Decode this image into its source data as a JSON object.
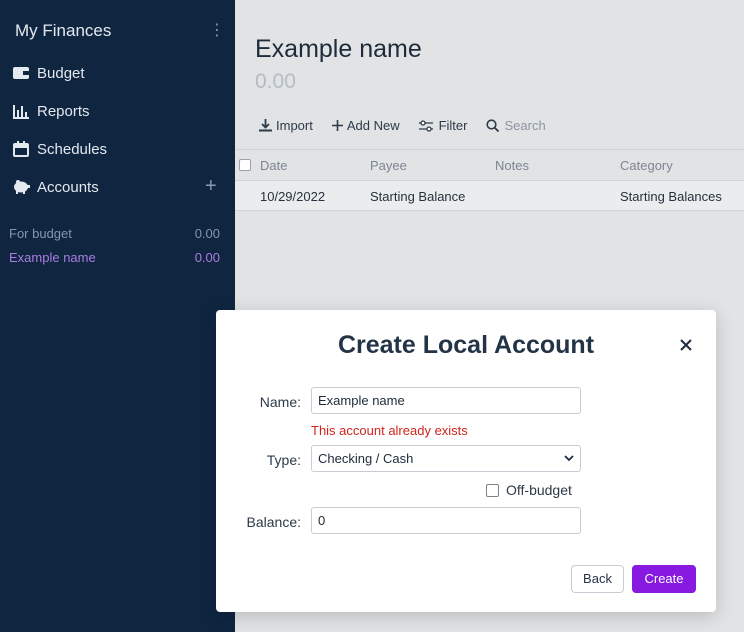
{
  "sidebar": {
    "title": "My Finances",
    "more_icon": "⋮",
    "nav": [
      {
        "label": "Budget",
        "icon": "wallet-icon"
      },
      {
        "label": "Reports",
        "icon": "bar-chart-icon"
      },
      {
        "label": "Schedules",
        "icon": "calendar-icon"
      },
      {
        "label": "Accounts",
        "icon": "piggy-bank-icon"
      }
    ],
    "add_icon": "+",
    "accounts": [
      {
        "name": "For budget",
        "balance": "0.00"
      },
      {
        "name": "Example name",
        "balance": "0.00"
      }
    ]
  },
  "account": {
    "name": "Example name",
    "balance": "0.00"
  },
  "toolbar": {
    "import_label": "Import",
    "add_new_label": "Add New",
    "filter_label": "Filter",
    "search_placeholder": "Search"
  },
  "table": {
    "headers": [
      "Date",
      "Payee",
      "Notes",
      "Category"
    ],
    "rows": [
      {
        "date": "10/29/2022",
        "payee": "Starting Balance",
        "notes": "",
        "category": "Starting Balances"
      }
    ]
  },
  "modal": {
    "title": "Create Local Account",
    "name_label": "Name:",
    "name_value": "Example name",
    "error": "This account already exists",
    "type_label": "Type:",
    "type_value": "Checking / Cash",
    "offbudget_label": "Off-budget",
    "balance_label": "Balance:",
    "balance_value": "0",
    "back_label": "Back",
    "create_label": "Create"
  },
  "colors": {
    "sidebar_bg": "#0f2540",
    "accent": "#8719e0",
    "error": "#d0241f",
    "selected_account": "#a97de0"
  }
}
